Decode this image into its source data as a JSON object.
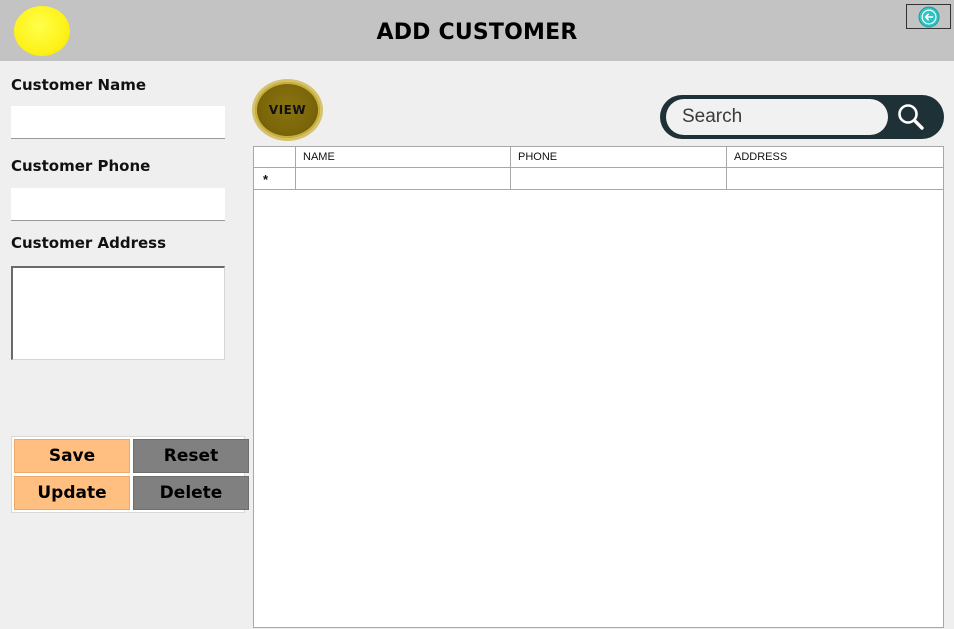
{
  "header": {
    "title": "ADD CUSTOMER",
    "logo_icon": "yellow-circle-logo",
    "back_icon": "back-arrow-icon"
  },
  "form": {
    "name_label": "Customer Name",
    "name_value": "",
    "phone_label": "Customer Phone",
    "phone_value": "",
    "address_label": "Customer Address",
    "address_value": ""
  },
  "buttons": {
    "save": "Save",
    "reset": "Reset",
    "update": "Update",
    "delete": "Delete"
  },
  "view_button": {
    "label": "VIEW"
  },
  "search": {
    "placeholder": "Search",
    "icon": "search-icon"
  },
  "grid": {
    "columns": [
      "NAME",
      "PHONE",
      "ADDRESS"
    ],
    "new_row_marker": "*",
    "rows": []
  },
  "colors": {
    "header_bg": "#c3c3c3",
    "primary_button": "#ffbf80",
    "secondary_button": "#808080",
    "search_frame": "#1e3136",
    "back_icon": "#2ec4c4"
  }
}
